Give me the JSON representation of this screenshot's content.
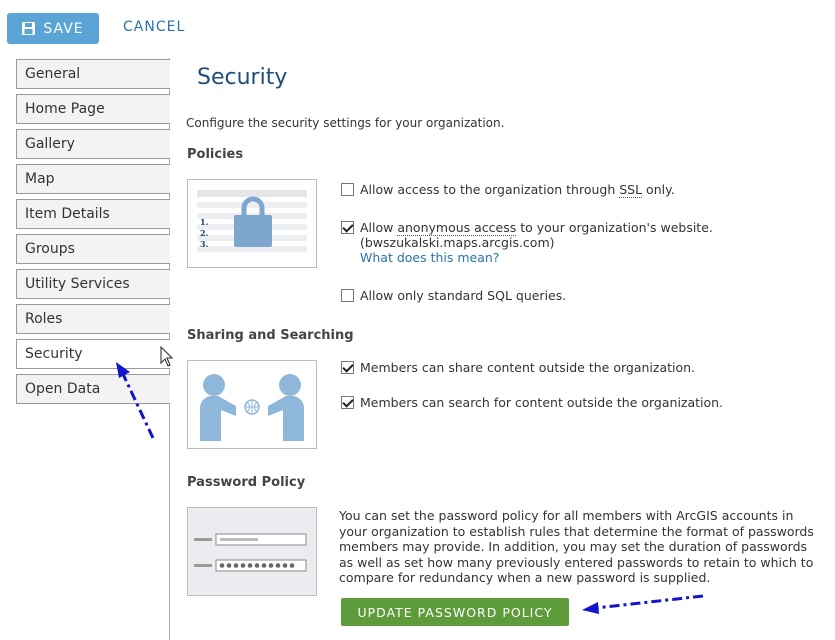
{
  "toolbar": {
    "save_label": "SAVE",
    "cancel_label": "CANCEL"
  },
  "sidebar": {
    "items": [
      {
        "label": "General"
      },
      {
        "label": "Home Page"
      },
      {
        "label": "Gallery"
      },
      {
        "label": "Map"
      },
      {
        "label": "Item Details"
      },
      {
        "label": "Groups"
      },
      {
        "label": "Utility Services"
      },
      {
        "label": "Roles"
      },
      {
        "label": "Security"
      },
      {
        "label": "Open Data"
      }
    ],
    "active": "Security"
  },
  "main": {
    "title": "Security",
    "intro": "Configure the security settings for your organization.",
    "policies": {
      "heading": "Policies",
      "ssl_pre": "Allow access to the organization through ",
      "ssl_abbr": "SSL",
      "ssl_post": " only.",
      "anon_pre": "Allow ",
      "anon_link": "anonymous access",
      "anon_post": " to your organization's website.",
      "anon_host": "(bwszukalski.maps.arcgis.com)",
      "anon_help": "What does this mean?",
      "sql_label": "Allow only standard SQL queries."
    },
    "sharing": {
      "heading": "Sharing and Searching",
      "share_label": "Members can share content outside the organization.",
      "search_label": "Members can search for content outside the organization."
    },
    "password": {
      "heading": "Password Policy",
      "description": "You can set the password policy for all members with ArcGIS accounts in your organization to establish rules that determine the format of passwords members may provide. In addition, you may set the duration of passwords as well as set how many previously entered passwords to retain to which to compare for redundancy when a new password is supplied.",
      "button_label": "UPDATE PASSWORD POLICY"
    }
  },
  "checkboxes": {
    "ssl": false,
    "anonymous": true,
    "sql": false,
    "share": true,
    "search": true
  },
  "icons": [
    "floppy-icon",
    "lock-icon",
    "people-sharing-icon",
    "password-form-icon",
    "mouse-cursor-icon",
    "annotation-arrow"
  ],
  "colors": {
    "save": "#5aa4d6",
    "update": "#5e9c3b",
    "title": "#1f4d78",
    "link": "#2a73ad",
    "annotation": "#1414cc"
  }
}
